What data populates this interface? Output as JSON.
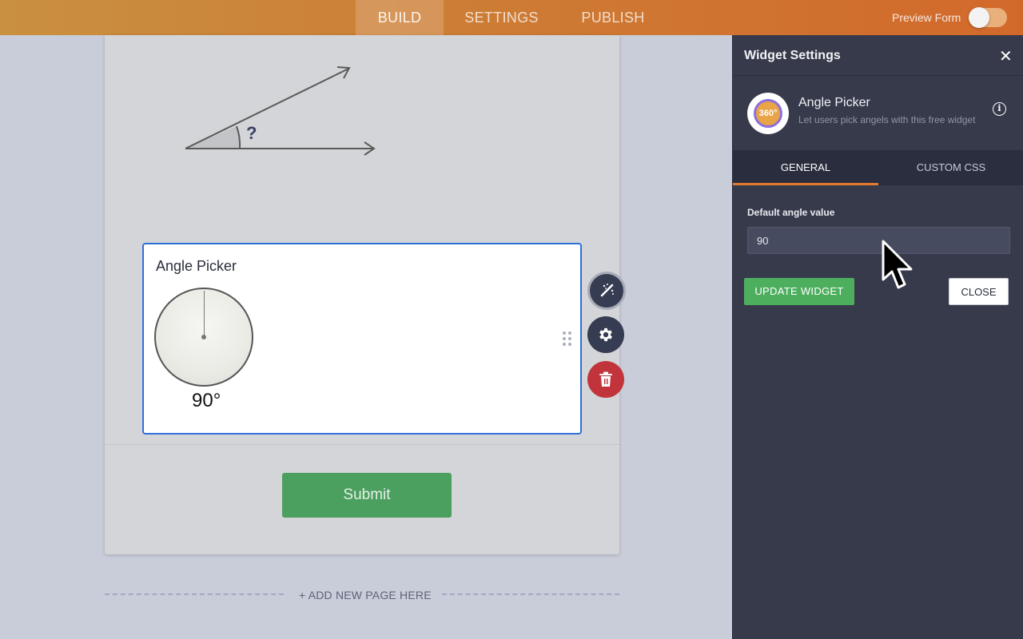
{
  "topbar": {
    "tabs": [
      {
        "label": "BUILD",
        "active": true
      },
      {
        "label": "SETTINGS",
        "active": false
      },
      {
        "label": "PUBLISH",
        "active": false
      }
    ],
    "preview_label": "Preview Form",
    "preview_enabled": false
  },
  "form": {
    "image": {
      "question_mark": "?"
    },
    "widget": {
      "title": "Angle Picker",
      "angle_display": "90°"
    },
    "submit_label": "Submit",
    "add_page_label": "+ ADD NEW PAGE HERE",
    "side_actions": {
      "wand_icon": "magic-wand-icon",
      "gear_icon": "gear-icon",
      "trash_icon": "trash-icon"
    }
  },
  "panel": {
    "title": "Widget Settings",
    "close_symbol": "✕",
    "widget_name": "Angle Picker",
    "widget_description": "Let users pick angels with this free widget",
    "widget_badge": "360°",
    "info_symbol": "i",
    "tabs": [
      {
        "label": "GENERAL",
        "active": true
      },
      {
        "label": "CUSTOM CSS",
        "active": false
      }
    ],
    "field_label": "Default angle value",
    "field_value": "90",
    "update_label": "UPDATE WIDGET",
    "close_label": "CLOSE"
  },
  "colors": {
    "accent_orange": "#e37b2f",
    "selected_blue": "#2f6fd8",
    "submit_green": "#4b9f5f",
    "update_green": "#4daf5e",
    "delete_red": "#c2343b",
    "panel_bg": "#363a4b"
  }
}
